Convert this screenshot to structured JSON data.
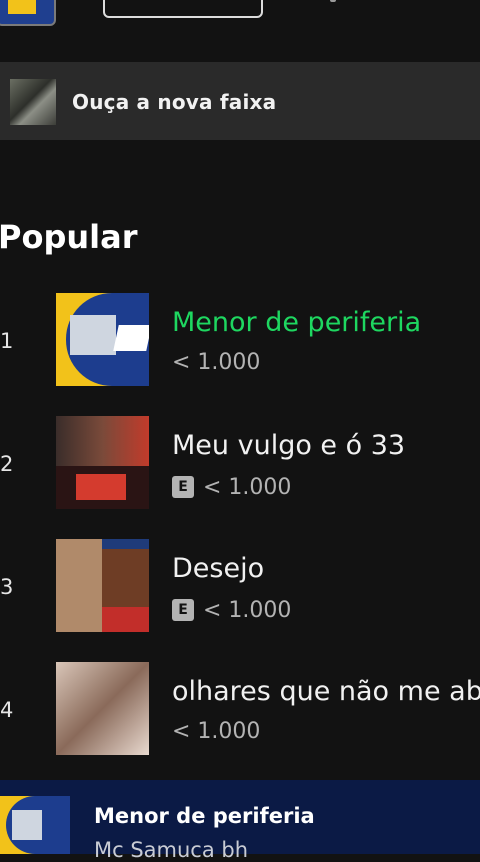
{
  "promo": {
    "text": "Ouça a nova faixa"
  },
  "section": {
    "title": "Popular"
  },
  "tracks": [
    {
      "rank": "1",
      "title": "Menor de periferia",
      "plays": "< 1.000",
      "explicit": false,
      "playing": true
    },
    {
      "rank": "2",
      "title": "Meu vulgo e ó 33",
      "plays": "< 1.000",
      "explicit": true,
      "explicit_label": "E",
      "playing": false
    },
    {
      "rank": "3",
      "title": "Desejo",
      "plays": "< 1.000",
      "explicit": true,
      "explicit_label": "E",
      "playing": false
    },
    {
      "rank": "4",
      "title": "olhares que não me ab",
      "plays": "< 1.000",
      "explicit": false,
      "playing": false
    }
  ],
  "now_playing": {
    "title": "Menor de periferia",
    "artist": "Mc Samuca bh"
  },
  "colors": {
    "accent": "#1ed760",
    "background": "#121212",
    "promo_bg": "#2a2a2a",
    "miniplayer_bg": "#0b1a45"
  }
}
